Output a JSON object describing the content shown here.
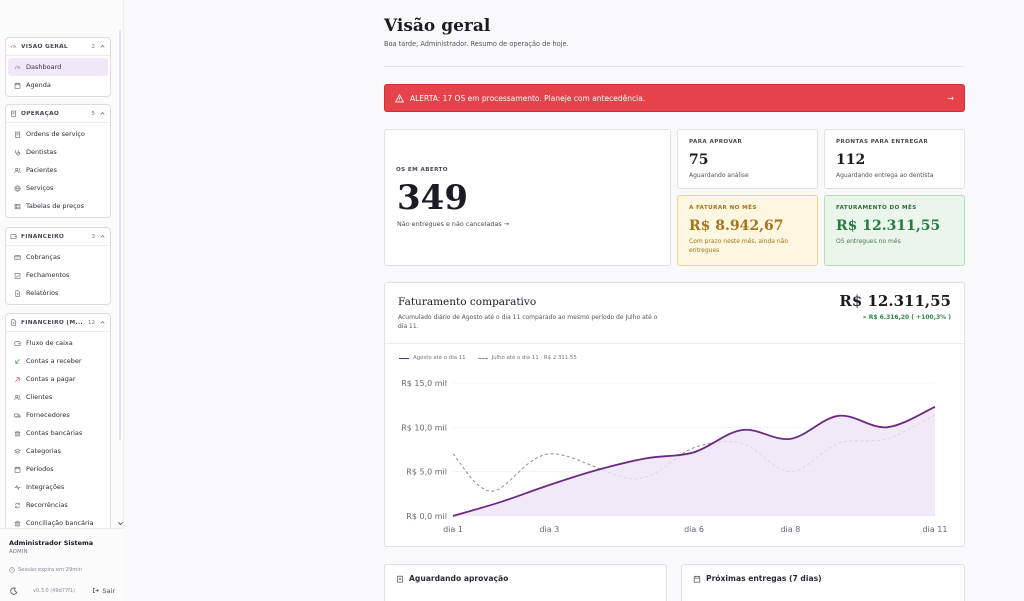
{
  "sidebar": {
    "sections": [
      {
        "title": "VISÃO GERAL",
        "count": "2",
        "items": [
          {
            "label": "Dashboard",
            "icon": "gauge-icon",
            "active": true
          },
          {
            "label": "Agenda",
            "icon": "calendar-icon"
          }
        ]
      },
      {
        "title": "OPERAÇÃO",
        "count": "5",
        "items": [
          {
            "label": "Ordens de serviço",
            "icon": "clipboard-icon"
          },
          {
            "label": "Dentistas",
            "icon": "stethoscope-icon"
          },
          {
            "label": "Pacientes",
            "icon": "users-icon"
          },
          {
            "label": "Serviços",
            "icon": "globe-icon"
          },
          {
            "label": "Tabelas de preços",
            "icon": "table-icon"
          }
        ]
      },
      {
        "title": "FINANCEIRO",
        "count": "3",
        "items": [
          {
            "label": "Cobranças",
            "icon": "card-icon"
          },
          {
            "label": "Fechamentos",
            "icon": "calendar-check-icon"
          },
          {
            "label": "Relatórios",
            "icon": "file-icon"
          }
        ]
      },
      {
        "title": "FINANCEIRO (M...",
        "count": "12",
        "items": [
          {
            "label": "Fluxo de caixa",
            "icon": "wallet-icon"
          },
          {
            "label": "Contas a receber",
            "icon": "arrow-down-left-icon"
          },
          {
            "label": "Contas a pagar",
            "icon": "arrow-up-right-icon"
          },
          {
            "label": "Clientes",
            "icon": "users-icon"
          },
          {
            "label": "Fornecedores",
            "icon": "truck-icon"
          },
          {
            "label": "Contas bancárias",
            "icon": "bank-icon"
          },
          {
            "label": "Categorias",
            "icon": "layers-icon"
          },
          {
            "label": "Períodos",
            "icon": "calendar-icon"
          },
          {
            "label": "Integrações",
            "icon": "activity-icon"
          },
          {
            "label": "Recorrências",
            "icon": "repeat-icon"
          },
          {
            "label": "Conciliação bancária",
            "icon": "bank-icon"
          }
        ]
      }
    ],
    "user": {
      "name": "Administrador Sistema",
      "role": "ADMIN"
    },
    "session": "Sessão expira em 29min",
    "version": "v0.3.0 (49d77f1)",
    "logout_label": "Sair"
  },
  "header": {
    "title": "Visão geral",
    "subtitle": "Boa tarde, Administrador. Resumo de operação de hoje."
  },
  "alert": {
    "text": "ALERTA: 17 OS em processamento. Planeje com antecedência.",
    "arrow": "→",
    "color": "#e5424a"
  },
  "kpis": {
    "open": {
      "label": "OS EM ABERTO",
      "value": "349",
      "sub": "Não entregues e não canceladas →"
    },
    "approve": {
      "label": "PARA APROVAR",
      "value": "75",
      "sub": "Aguardando análise"
    },
    "ready": {
      "label": "PRONTAS PARA ENTREGAR",
      "value": "112",
      "sub": "Aguardando entrega ao dentista"
    },
    "to_bill": {
      "label": "A FATURAR NO MÊS",
      "value": "R$ 8.942,67",
      "sub": "Com prazo neste mês, ainda não entregues"
    },
    "billed": {
      "label": "FATURAMENTO DO MÊS",
      "value": "R$ 12.311,55",
      "sub": "OS entregues no mês"
    }
  },
  "chart": {
    "title": "Faturamento comparativo",
    "description": "Acumulado diário de Agosto até o dia 11 comparado ao mesmo período de Julho até o dia 11.",
    "total": "R$ 12.311,55",
    "delta": "» R$ 6.316,20 ( +100,3% )"
  },
  "chart_data": {
    "type": "line",
    "x_ticks": [
      "dia 1",
      "dia 3",
      "dia 6",
      "dia 8",
      "dia 11"
    ],
    "y_ticks": [
      "R$ 0,0 mil",
      "R$ 5,0 mil",
      "R$ 10,0 mil",
      "R$ 15,0 mil"
    ],
    "ylim": [
      0,
      15000
    ],
    "xlim": [
      1,
      11
    ],
    "series": [
      {
        "name": "Agosto até o dia 11",
        "color": "#6b2a82",
        "style": "solid",
        "area": true,
        "points": [
          [
            1,
            0
          ],
          [
            2,
            1600
          ],
          [
            3,
            3500
          ],
          [
            4,
            5200
          ],
          [
            5,
            6500
          ],
          [
            6,
            7200
          ],
          [
            7,
            9700
          ],
          [
            8,
            8700
          ],
          [
            9,
            11300
          ],
          [
            10,
            10000
          ],
          [
            11,
            12311
          ]
        ]
      },
      {
        "name": "Julho até o dia 11 · R$ 2.311,55",
        "color": "#8e8a96",
        "style": "dashed",
        "area": false,
        "points": [
          [
            1,
            7000
          ],
          [
            1.8,
            2800
          ],
          [
            3,
            7000
          ],
          [
            4.8,
            4200
          ],
          [
            6,
            7700
          ],
          [
            7,
            8200
          ],
          [
            8,
            5000
          ],
          [
            9,
            8200
          ],
          [
            10,
            8700
          ],
          [
            11,
            11400
          ]
        ]
      }
    ]
  },
  "panels": {
    "pending": "Aguardando aprovação",
    "deliveries": "Próximas entregas (7 dias)"
  }
}
